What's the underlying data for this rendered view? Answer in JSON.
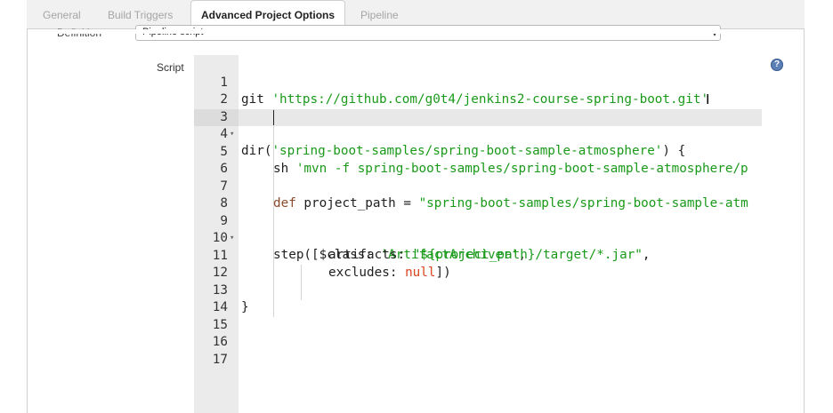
{
  "tabs": [
    {
      "label": "General"
    },
    {
      "label": "Build Triggers"
    },
    {
      "label": "Advanced Project Options"
    },
    {
      "label": "Pipeline"
    }
  ],
  "definition": {
    "label": "Definition",
    "value": "Pipeline script"
  },
  "script": {
    "label": "Script",
    "help": "?"
  },
  "editor": {
    "line_numbers": [
      "1",
      "2",
      "3",
      "4",
      "5",
      "6",
      "7",
      "8",
      "9",
      "10",
      "11",
      "12",
      "13",
      "14",
      "15",
      "16",
      "17"
    ],
    "lines": {
      "l1_kw": "git ",
      "l1_str": "'https://github.com/g0t4/jenkins2-course-spring-boot.git'",
      "l3_a": "dir(",
      "l3_str": "'spring-boot-samples/spring-boot-sample-atmosphere'",
      "l3_b": ") {",
      "l5_a": "sh ",
      "l5_str": "'mvn -f spring-boot-samples/spring-boot-sample-atmosphere/p",
      "l7_kw": "def",
      "l7_a": " project_path = ",
      "l7_str": "\"spring-boot-samples/spring-boot-sample-atm",
      "l9_a": "step([$class: ",
      "l9_str": "'ArtifactArchiver'",
      "l9_b": ",",
      "l10_a": "artifacts: ",
      "l10_str": "\"${project_path}/target/*.jar\"",
      "l10_b": ",",
      "l11_a": "excludes: ",
      "l11_null": "null",
      "l11_b": "])",
      "l13": "}"
    }
  }
}
